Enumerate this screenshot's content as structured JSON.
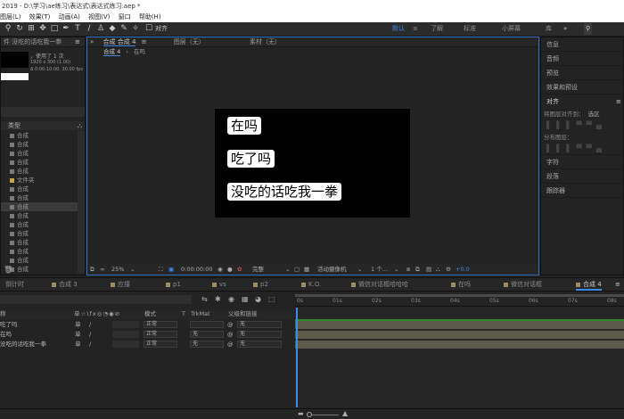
{
  "titlebar": {
    "title": "2019 - D:\\学习\\ae练习\\表达式\\表达式练习.aep *"
  },
  "menubar": {
    "items": [
      "图层(L)",
      "效果(T)",
      "动画(A)",
      "视图(V)",
      "窗口",
      "帮助(H)"
    ]
  },
  "toolbar": {
    "align_label": "对齐",
    "workspaces": [
      "默认",
      "了解",
      "标准",
      "小屏幕",
      "库"
    ],
    "search_placeholder": "搜索帮助"
  },
  "project": {
    "header_title": "件 没吃的话吃我一拳",
    "used_label": "，使用了 1 次",
    "dims": "1920 x 300 (1.00)",
    "duration": "Δ 0:00:10:00, 30.00 fps",
    "type_column": "类型",
    "rows": [
      "合成",
      "合成",
      "合成",
      "合成",
      "合成",
      "文件夹",
      "合成",
      "合成",
      "合成",
      "合成",
      "合成",
      "合成",
      "合成",
      "合成",
      "合成",
      "合成"
    ]
  },
  "comp_panel": {
    "tab_label": "合成 合成 4",
    "layer_label": "图层（无）",
    "footage_label": "素材（无）",
    "breadcrumb": [
      "合成 4",
      "在吗"
    ],
    "texts": [
      "在吗",
      "吃了吗",
      "没吃的话吃我一拳"
    ],
    "zoom": "25%",
    "timecode": "0:00:00:00",
    "quality": "完整",
    "camera": "活动摄像机",
    "views": "1 个...",
    "exposure": "+0.0"
  },
  "right_panel": {
    "items": [
      "信息",
      "音频",
      "预览",
      "效果和预设",
      "对齐",
      "将图层对齐到：",
      "分布图层：",
      "字符",
      "段落",
      "跟踪器"
    ],
    "align_target": "选区"
  },
  "timeline": {
    "tabs": [
      "倒计时",
      "合成 3",
      "应撞",
      "p1",
      "vs",
      "p2",
      "K.O.",
      "微信对话框哈哈哈",
      "在吗",
      "微信对话框",
      "合成 4"
    ],
    "column_headers": {
      "name": "称",
      "mode": "模式",
      "t": "T",
      "trkmat": "TrkMat",
      "parent": "父级和链接"
    },
    "layers": [
      {
        "name": "吃了吗",
        "mode": "正常",
        "trkmat": "",
        "parent": "无"
      },
      {
        "name": "在吗",
        "mode": "正常",
        "trkmat": "无",
        "parent": "无"
      },
      {
        "name": "没吃的话吃我一拳",
        "mode": "正常",
        "trkmat": "无",
        "parent": "无"
      }
    ],
    "ruler": [
      "0s",
      "01s",
      "02s",
      "03s",
      "04s",
      "05s",
      "06s",
      "07s",
      "08s"
    ]
  },
  "colors": {
    "accent": "#3d8be6",
    "layer_bar": "#5c5a4a",
    "canvas": "#000000"
  }
}
